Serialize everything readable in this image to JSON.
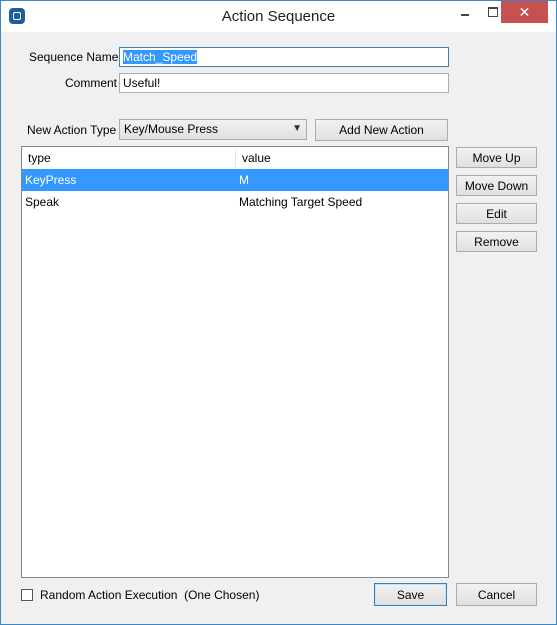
{
  "window": {
    "title": "Action Sequence"
  },
  "form": {
    "sequence_name_label": "Sequence Name",
    "sequence_name_value": "Match_Speed",
    "comment_label": "Comment",
    "comment_value": "Useful!",
    "new_action_type_label": "New Action Type",
    "new_action_type_value": "Key/Mouse Press",
    "add_new_action_label": "Add New Action"
  },
  "list": {
    "columns": [
      "type",
      "value"
    ],
    "rows": [
      {
        "type": "KeyPress",
        "value": "M",
        "selected": true
      },
      {
        "type": "Speak",
        "value": "Matching Target Speed",
        "selected": false
      }
    ]
  },
  "side_buttons": {
    "move_up": "Move Up",
    "move_down": "Move Down",
    "edit": "Edit",
    "remove": "Remove"
  },
  "footer": {
    "random_label": "Random Action Execution  (One Chosen)",
    "random_checked": false,
    "save_label": "Save",
    "cancel_label": "Cancel"
  },
  "colors": {
    "selection": "#3399ff",
    "close_button": "#c75050",
    "window_border": "#3b86c7"
  },
  "icons": {
    "app": "app-icon",
    "minimize": "minimize-icon",
    "maximize": "maximize-icon",
    "close": "close-icon",
    "dropdown": "chevron-down-icon"
  }
}
